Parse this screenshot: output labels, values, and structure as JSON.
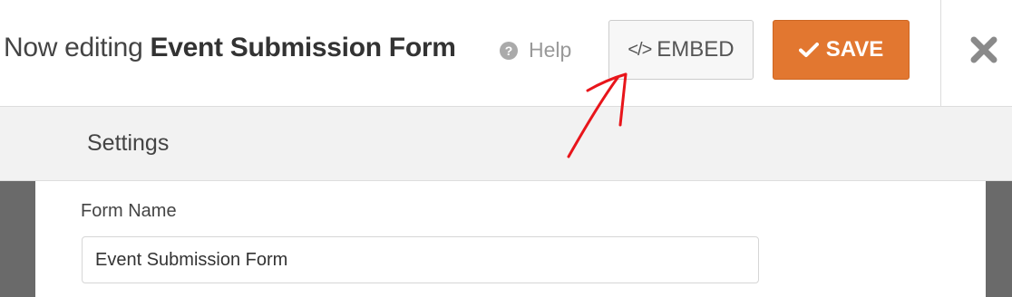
{
  "header": {
    "editing_prefix": "Now editing",
    "form_title": "Event Submission Form",
    "help_label": "Help",
    "help_icon": "?",
    "embed_icon": "</>",
    "embed_label": "EMBED",
    "save_label": "SAVE",
    "close_icon": "close-icon"
  },
  "settings": {
    "title": "Settings"
  },
  "form": {
    "name_label": "Form Name",
    "name_value": "Event Submission Form"
  },
  "colors": {
    "save_accent": "#e27730",
    "annotation": "#e8151b"
  }
}
